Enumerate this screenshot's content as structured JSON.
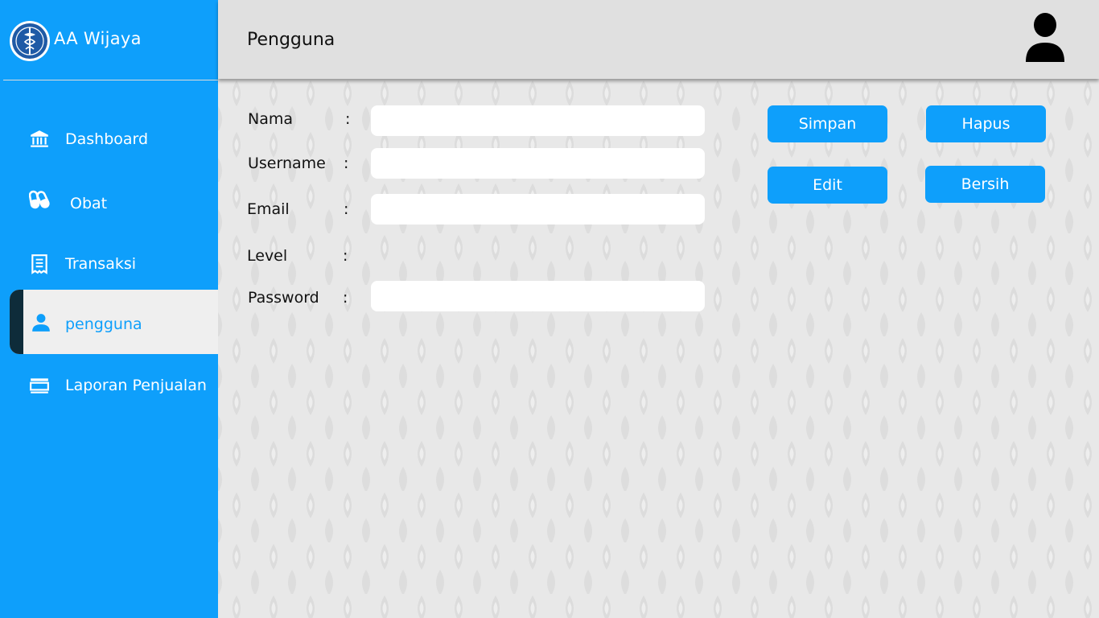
{
  "app": {
    "name": "AA Wijaya"
  },
  "header": {
    "title": "Pengguna"
  },
  "sidebar": {
    "items": [
      {
        "label": "Dashboard",
        "icon": "bank-icon"
      },
      {
        "label": "Obat",
        "icon": "pills-icon"
      },
      {
        "label": "Transaksi",
        "icon": "receipt-icon"
      },
      {
        "label": "pengguna",
        "icon": "user-icon",
        "active": true
      },
      {
        "label": "Laporan Penjualan",
        "icon": "report-icon"
      }
    ]
  },
  "form": {
    "colon": ":",
    "fields": {
      "nama": {
        "label": "Nama",
        "value": ""
      },
      "username": {
        "label": "Username",
        "value": ""
      },
      "email": {
        "label": "Email",
        "value": ""
      },
      "level": {
        "label": "Level",
        "value": ""
      },
      "password": {
        "label": "Password",
        "value": ""
      }
    }
  },
  "actions": {
    "simpan": "Simpan",
    "hapus": "Hapus",
    "edit": "Edit",
    "bersih": "Bersih"
  },
  "colors": {
    "sidebar": "#0e9ffb",
    "active_bar": "#0e2c3a",
    "active_bg": "#efefef",
    "header": "#e0e0e0",
    "button": "#0e9ffb"
  }
}
